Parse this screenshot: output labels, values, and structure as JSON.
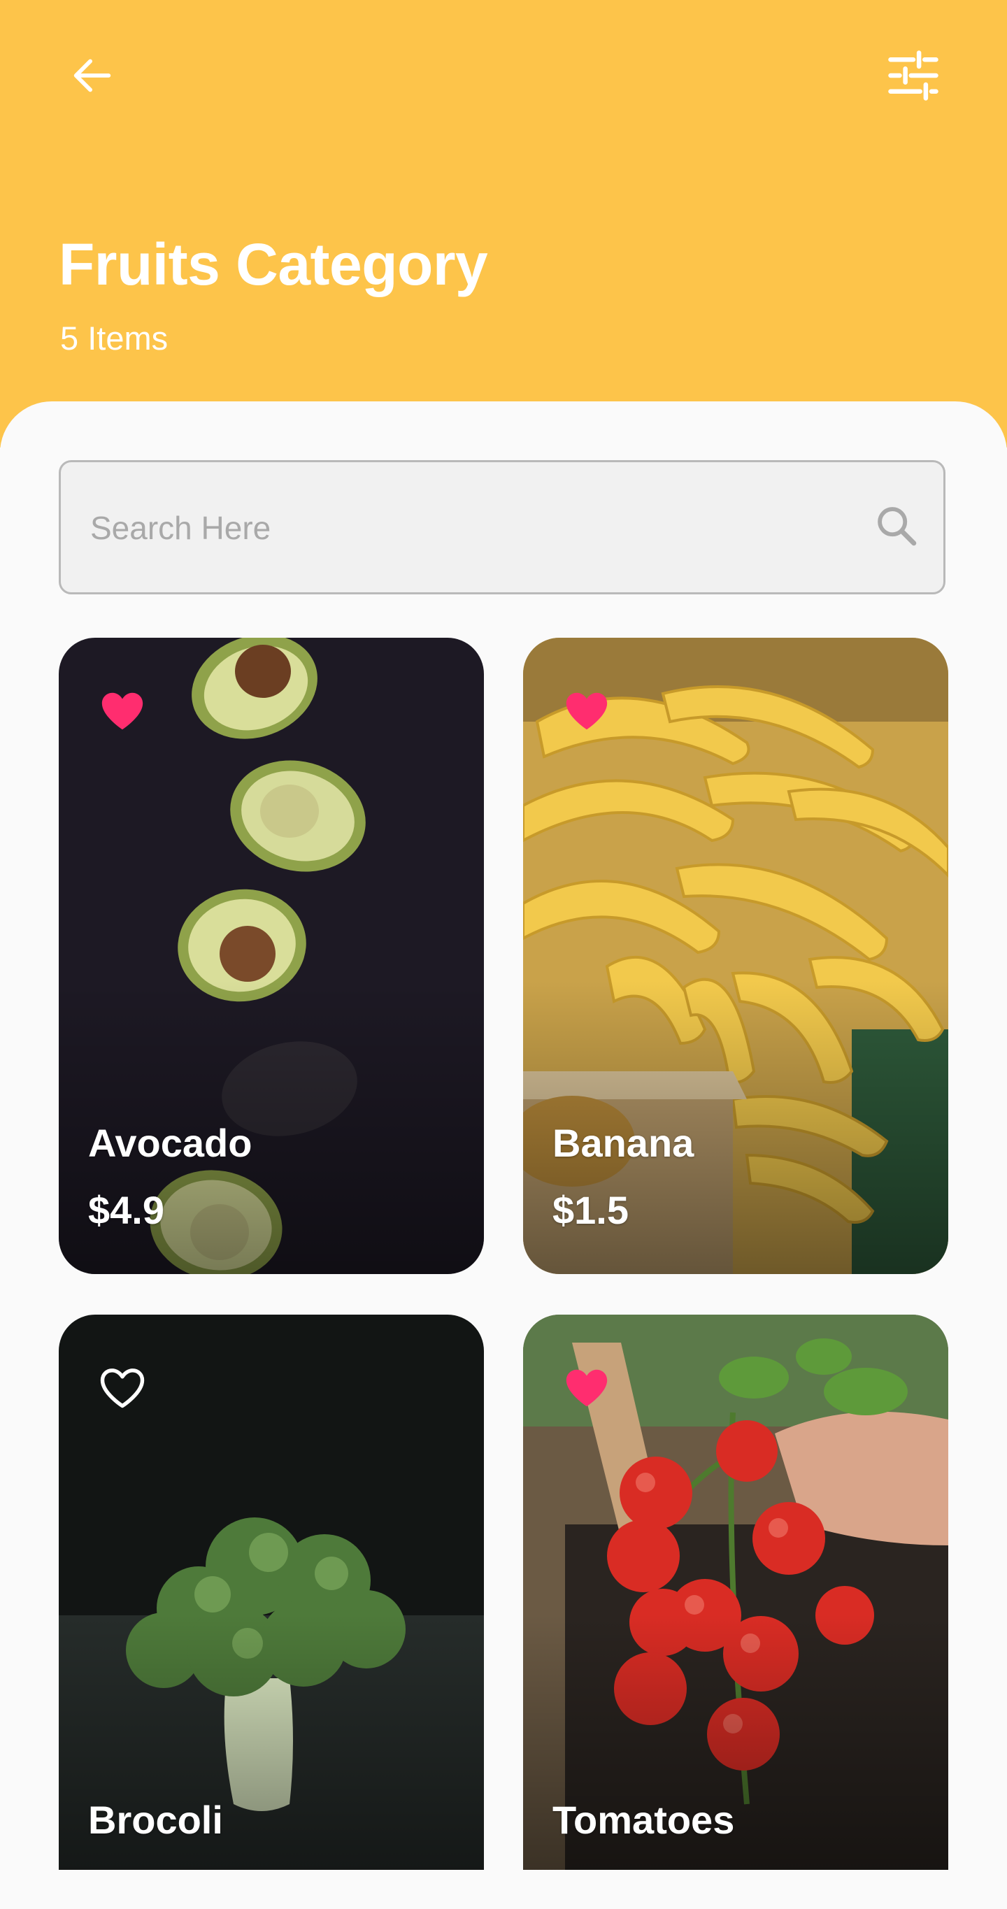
{
  "colors": {
    "header_bg": "#FDC44A",
    "page_bg": "#FAFAFA",
    "favorite_active": "#FF2D6F",
    "favorite_inactive": "#FFFFFF"
  },
  "header": {
    "back_icon": "arrow-left-icon",
    "filter_icon": "sliders-icon",
    "title": "Fruits Category",
    "subtitle": "5 Items"
  },
  "search": {
    "placeholder": "Search Here",
    "value": "",
    "icon": "search-icon"
  },
  "products": [
    {
      "name": "Avocado",
      "price": "$4.9",
      "favorite": true
    },
    {
      "name": "Banana",
      "price": "$1.5",
      "favorite": true
    },
    {
      "name": "Brocoli",
      "price": "",
      "favorite": false
    },
    {
      "name": "Tomatoes",
      "price": "",
      "favorite": true
    }
  ]
}
